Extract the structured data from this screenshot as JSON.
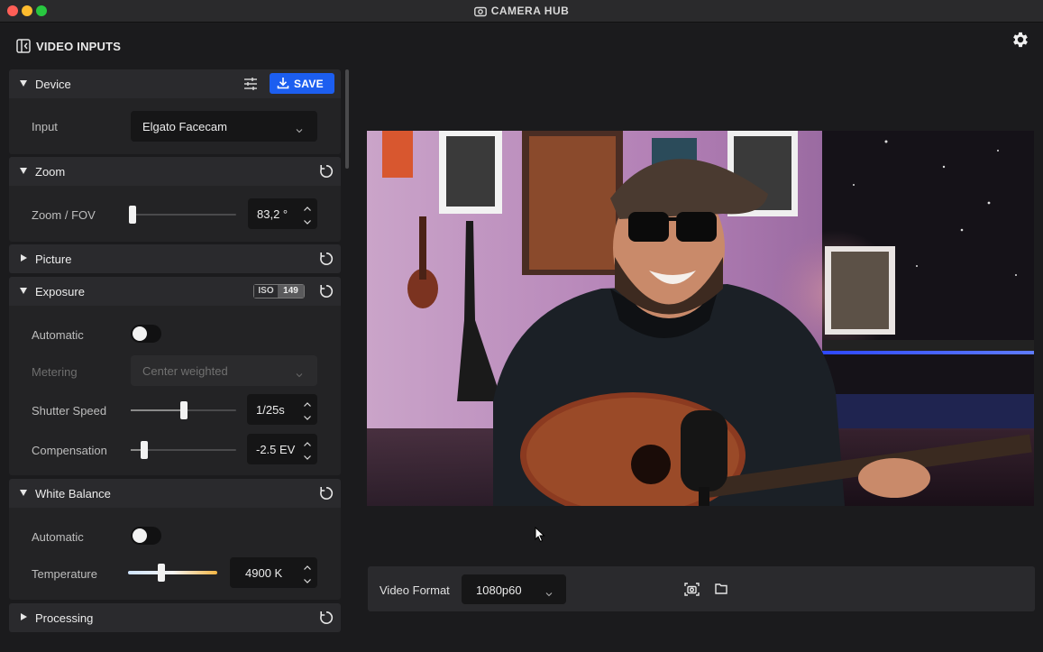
{
  "window": {
    "title": "CAMERA HUB"
  },
  "header": {
    "panel_title": "VIDEO INPUTS"
  },
  "device": {
    "label": "Device",
    "save_label": "SAVE",
    "input_label": "Input",
    "input_value": "Elgato Facecam"
  },
  "zoom": {
    "label": "Zoom",
    "fov_label": "Zoom / FOV",
    "fov_value": "83,2 °",
    "fov_level": 0.02
  },
  "picture": {
    "label": "Picture"
  },
  "exposure": {
    "label": "Exposure",
    "iso_label": "ISO",
    "iso_value": "149",
    "automatic_label": "Automatic",
    "automatic_on": false,
    "metering_label": "Metering",
    "metering_value": "Center weighted",
    "shutter_label": "Shutter Speed",
    "shutter_value": "1/25s",
    "shutter_level": 0.5,
    "comp_label": "Compensation",
    "comp_value": "-2.5 EV",
    "comp_level": 0.13
  },
  "white_balance": {
    "label": "White Balance",
    "automatic_label": "Automatic",
    "automatic_on": false,
    "temp_label": "Temperature",
    "temp_value": "4900 K",
    "temp_level": 0.37
  },
  "processing": {
    "label": "Processing"
  },
  "footer": {
    "video_format_label": "Video Format",
    "video_format_value": "1080p60"
  },
  "colors": {
    "accent": "#1c5ef0",
    "toggle_knob": "#f2f2f2"
  }
}
